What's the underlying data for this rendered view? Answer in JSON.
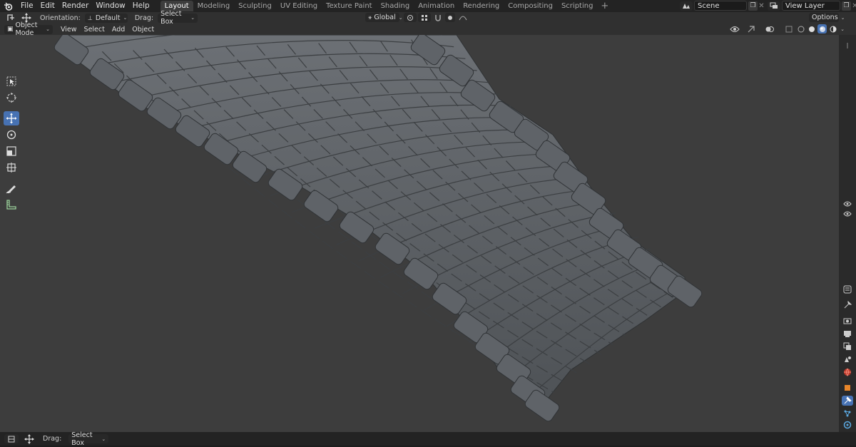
{
  "topbar": {
    "menu": [
      "File",
      "Edit",
      "Render",
      "Window",
      "Help"
    ],
    "workspaces": [
      "Layout",
      "Modeling",
      "Sculpting",
      "UV Editing",
      "Texture Paint",
      "Shading",
      "Animation",
      "Rendering",
      "Compositing",
      "Scripting"
    ],
    "active_workspace": "Layout",
    "add_tab": "+",
    "scene": "Scene",
    "view_layer": "View Layer"
  },
  "tool_header": {
    "orientation_label": "Orientation:",
    "orientation_value": "Default",
    "drag_label": "Drag:",
    "drag_value": "Select Box",
    "transform_orientation": "Global",
    "options": "Options"
  },
  "view_header": {
    "mode": "Object Mode",
    "menus": [
      "View",
      "Select",
      "Add",
      "Object"
    ]
  },
  "statusbar": {
    "drag_label": "Drag:",
    "drag_value": "Select Box"
  },
  "viewport": {
    "background": "#3d3d3d",
    "object": "stone bridge / cobblestone path model",
    "stone_color": "#5e6266"
  },
  "colors": {
    "accent": "#4772b3",
    "header": "#303030",
    "topbar": "#232323"
  },
  "icons": {
    "toolbar": [
      "select-box-icon",
      "cursor-icon",
      "move-icon",
      "rotate-icon",
      "scale-icon",
      "transform-icon",
      "annotate-icon",
      "measure-icon"
    ],
    "properties": [
      "tool-icon",
      "render-icon",
      "output-icon",
      "view-layer-icon",
      "scene-icon",
      "world-icon",
      "object-icon",
      "modifier-icon",
      "particles-icon",
      "physics-icon",
      "constraints-icon"
    ]
  }
}
